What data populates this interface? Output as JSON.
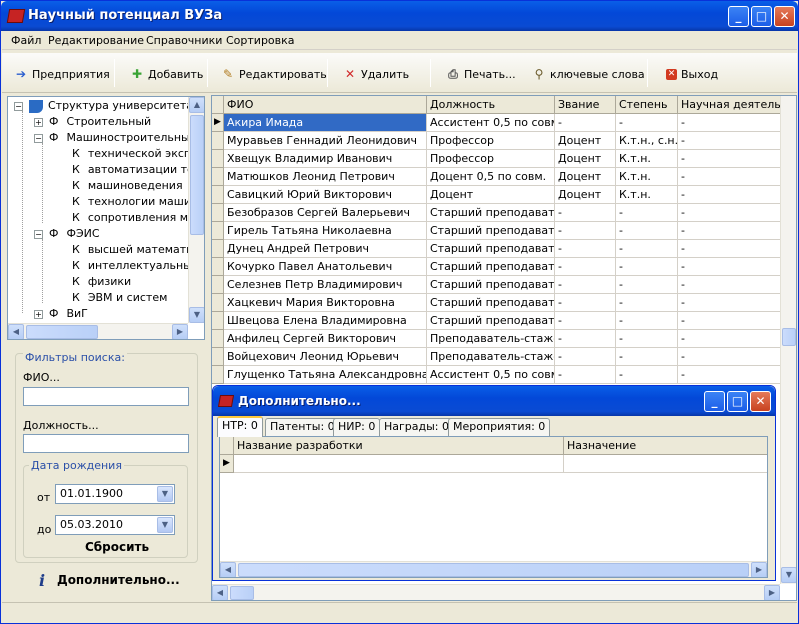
{
  "window": {
    "title": "Научный потенциал ВУЗа",
    "minimize": "_",
    "maximize": "□",
    "close": "✕"
  },
  "menu": [
    "Файл",
    "Редактирование",
    "Справочники",
    "Сортировка"
  ],
  "toolbar": {
    "enterprises": "Предприятия",
    "add": "Добавить",
    "edit": "Редактировать",
    "delete": "Удалить",
    "print": "Печать...",
    "keywords": "ключевые слова",
    "exit": "Выход"
  },
  "tree": {
    "root": "Структура университета",
    "nodes": [
      {
        "prefix": "Ф",
        "label": "Строительный",
        "expanded": false
      },
      {
        "prefix": "Ф",
        "label": "Машиностроительный",
        "expanded": true,
        "children": [
          "технической эксплуатации",
          "автоматизации технологий",
          "машиноведения",
          "технологии машиностроения",
          "сопротивления материалов"
        ]
      },
      {
        "prefix": "Ф",
        "label": "ФЭИС",
        "expanded": true,
        "children": [
          "высшей математики",
          "интеллектуальных систем",
          "физики",
          "ЭВМ и систем"
        ]
      },
      {
        "prefix": "Ф",
        "label": "ВиГ",
        "expanded": false
      }
    ],
    "child_prefix": "К"
  },
  "filters": {
    "title": "Фильтры поиска:",
    "fio_label": "ФИО...",
    "fio_value": "",
    "position_label": "Должность...",
    "position_value": "",
    "birth_title": "Дата рождения",
    "from_label": "от",
    "from_value": "01.01.1900",
    "to_label": "до",
    "to_value": "05.03.2010",
    "reset": "Сбросить"
  },
  "more_button": "Дополнительно...",
  "grid": {
    "columns": [
      "ФИО",
      "Должность",
      "Звание",
      "Степень",
      "Научная деятельность"
    ],
    "rows": [
      [
        "Акира Имада",
        "Ассистент 0,5 по совм.",
        "-",
        "-",
        "-"
      ],
      [
        "Муравьев Геннадий Леонидович",
        "Профессор",
        "Доцент",
        "К.т.н., с.н.с.",
        "-"
      ],
      [
        "Хвещук Владимир Иванович",
        "Профессор",
        "Доцент",
        "К.т.н.",
        "-"
      ],
      [
        "Матюшков Леонид Петрович",
        "Доцент 0,5 по совм.",
        "Доцент",
        "К.т.н.",
        "-"
      ],
      [
        "Савицкий Юрий Викторович",
        "Доцент",
        "Доцент",
        "К.т.н.",
        "-"
      ],
      [
        "Безобразов Сергей Валерьевич",
        "Старший преподаватель",
        "-",
        "-",
        "-"
      ],
      [
        "Гирель Татьяна Николаевна",
        "Старший преподаватель",
        "-",
        "-",
        "-"
      ],
      [
        "Дунец Андрей Петрович",
        "Старший преподаватель",
        "-",
        "-",
        "-"
      ],
      [
        "Кочурко Павел Анатольевич",
        "Старший преподаватель",
        "-",
        "-",
        "-"
      ],
      [
        "Селезнев Петр Владимирович",
        "Старший преподаватель",
        "-",
        "-",
        "-"
      ],
      [
        "Хацкевич Мария Викторовна",
        "Старший преподаватель",
        "-",
        "-",
        "-"
      ],
      [
        "Швецова Елена Владимировна",
        "Старший преподаватель",
        "-",
        "-",
        "-"
      ],
      [
        "Анфилец Сергей Викторович",
        "Преподаватель-стажер",
        "-",
        "-",
        "-"
      ],
      [
        "Войцехович Леонид Юрьевич",
        "Преподаватель-стажер",
        "-",
        "-",
        "-"
      ],
      [
        "Глущенко Татьяна Александровна",
        "Ассистент 0,5 по совм.",
        "-",
        "-",
        "-"
      ]
    ]
  },
  "subwindow": {
    "title": "Дополнительно...",
    "tabs": [
      "НТР: 0",
      "Патенты: 0",
      "НИР: 0",
      "Награды: 0",
      "Мероприятия: 0"
    ],
    "columns": [
      "Название разработки",
      "Назначение"
    ]
  }
}
